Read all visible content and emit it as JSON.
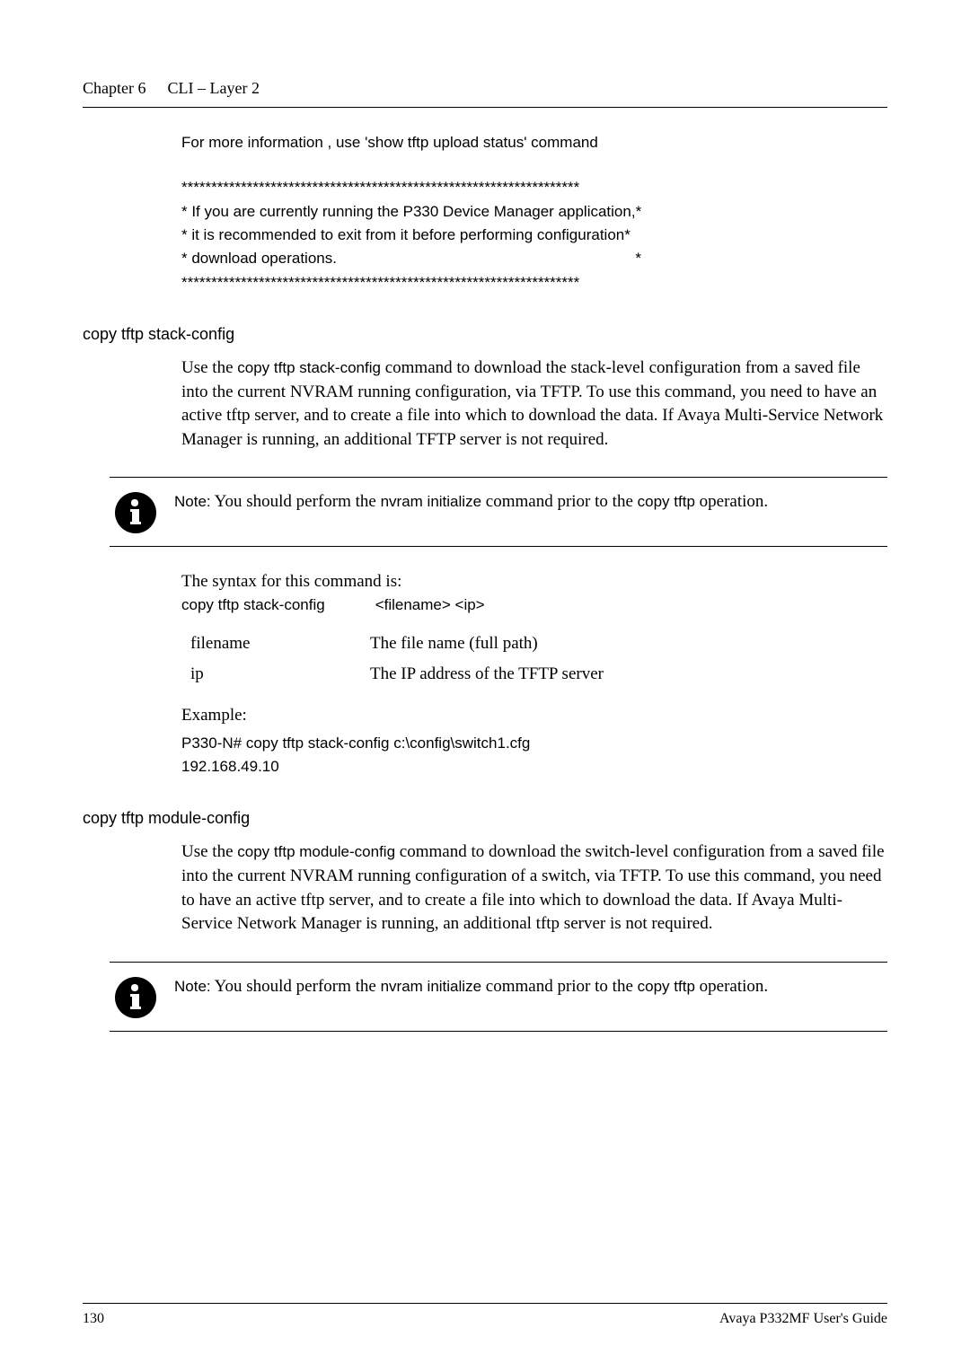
{
  "header": {
    "chapter": "Chapter 6",
    "title": "CLI – Layer 2"
  },
  "intro": {
    "more_info": "For more information , use 'show tftp upload status' command",
    "stars1": "*******************************************************************",
    "line1": "* If you are currently running the P330 Device Manager application,*",
    "line2": "* it is recommended to exit from it before performing configuration*",
    "line3_a": "* download operations.",
    "line3_b": "*",
    "stars2": "*******************************************************************"
  },
  "section1": {
    "heading": "copy tftp stack-config",
    "body_pre": "Use the ",
    "body_cmd": "copy tftp stack-config",
    "body_post": " command to download the stack-level configuration from a saved file into the current NVRAM running configuration, via TFTP. To use this command, you need to have an active tftp server, and to create a file into which to download the data. If Avaya Multi-Service Network Manager is running, an additional TFTP server is not required.",
    "note_label": "Note:",
    "note_pre": " You should perform the ",
    "note_cmd1": "nvram initialize",
    "note_mid": " command prior to the ",
    "note_cmd2": "copy tftp",
    "note_post": " operation.",
    "syntax_label": "The syntax for this command is:",
    "syntax_cmd": "copy tftp stack-config",
    "syntax_args": "<filename> <ip>",
    "param1_name": "filename",
    "param1_desc": "The file name (full path)",
    "param2_name": "ip",
    "param2_desc": "The IP address of the TFTP server",
    "example_label": "Example:",
    "example_line1": "P330-N# copy tftp stack-config c:\\config\\switch1.cfg",
    "example_line2": "192.168.49.10"
  },
  "section2": {
    "heading": "copy tftp module-config",
    "body_pre": "Use the ",
    "body_cmd": "copy tftp module-config",
    "body_post": " command to download the switch-level configuration from a saved file into the current NVRAM running configuration of a switch, via TFTP. To use this command, you need to have an active tftp server, and to create a file into which to download the data. If Avaya Multi-Service Network Manager is running, an additional tftp server is not required.",
    "note_label": "Note:",
    "note_pre": " You should perform the ",
    "note_cmd1": "nvram initialize",
    "note_mid": " command prior to the ",
    "note_cmd2": "copy tftp",
    "note_post": " operation."
  },
  "footer": {
    "page": "130",
    "guide": "Avaya P332MF User's Guide"
  }
}
